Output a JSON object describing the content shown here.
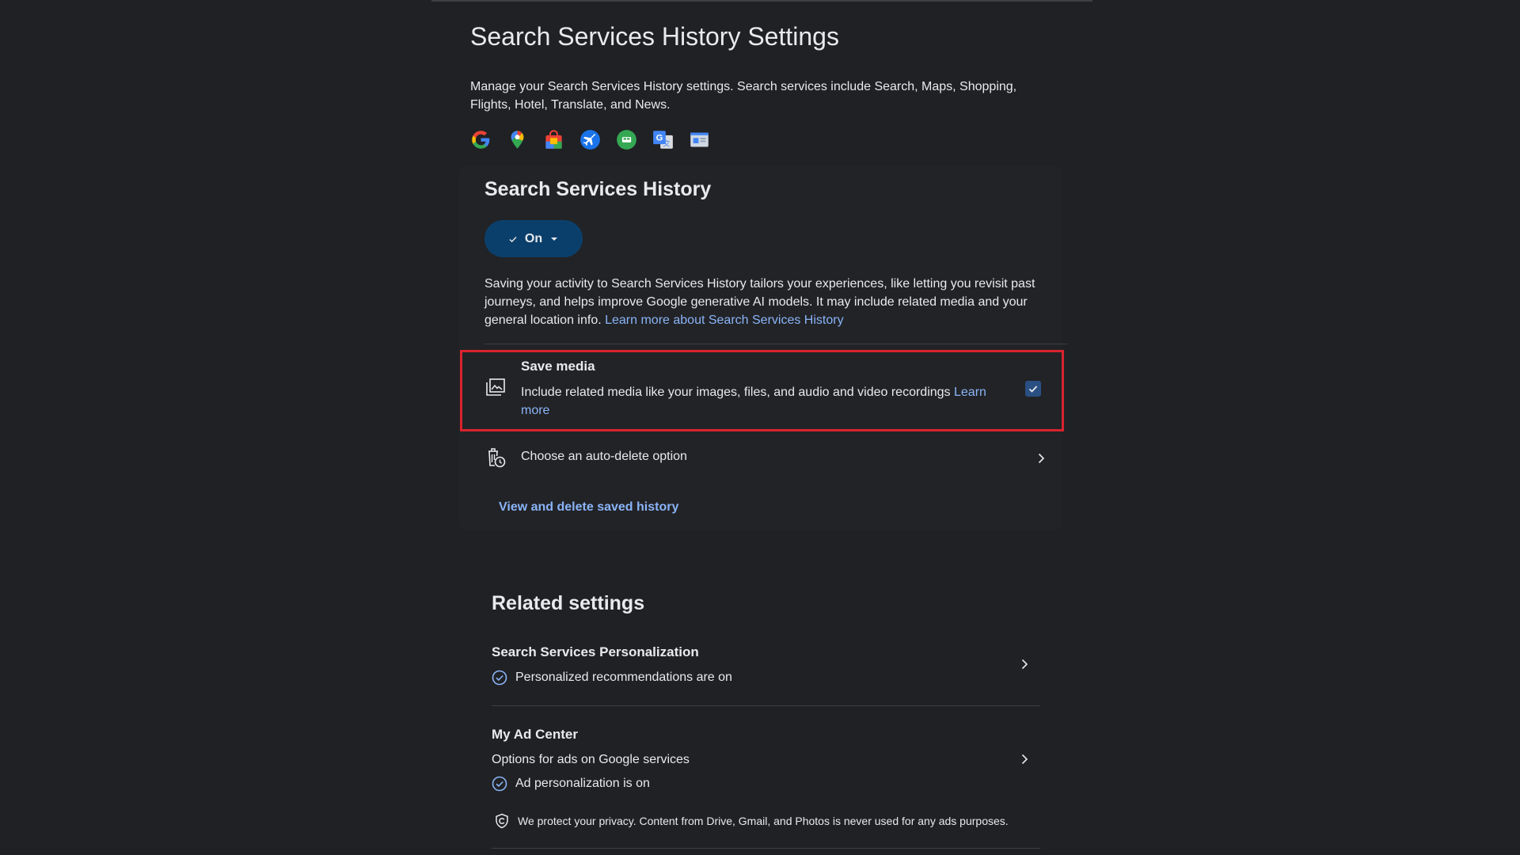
{
  "page": {
    "title": "Search Services History Settings",
    "intro": "Manage your Search Services History settings. Search services include Search, Maps, Shopping, Flights, Hotel, Translate, and News."
  },
  "service_icons": [
    "google-icon",
    "maps-icon",
    "shopping-icon",
    "flights-icon",
    "hotel-icon",
    "translate-icon",
    "news-icon"
  ],
  "history_card": {
    "title": "Search Services History",
    "toggle_label": "On",
    "description": "Saving your activity to Search Services History tailors your experiences, like letting you revisit past journeys, and helps improve Google generative AI models. It may include related media and your general location info.",
    "learn_more_link": "Learn more about Search Services History",
    "save_media": {
      "title": "Save media",
      "description": "Include related media like your images, files, and audio and video recordings",
      "learn_more": "Learn more",
      "checked": true
    },
    "auto_delete_label": "Choose an auto-delete option",
    "view_delete_link": "View and delete saved history"
  },
  "related": {
    "title": "Related settings",
    "personalization": {
      "title": "Search Services Personalization",
      "status": "Personalized recommendations are on"
    },
    "ad_center": {
      "title": "My Ad Center",
      "subtitle": "Options for ads on Google services",
      "status": "Ad personalization is on"
    },
    "privacy_note": "We protect your privacy. Content from Drive, Gmail, and Photos is never used for any ads purposes."
  },
  "colors": {
    "background": "#202124",
    "link": "#8ab4f8",
    "toggle_bg": "#0b3f6b",
    "highlight_border": "#d9232e"
  }
}
